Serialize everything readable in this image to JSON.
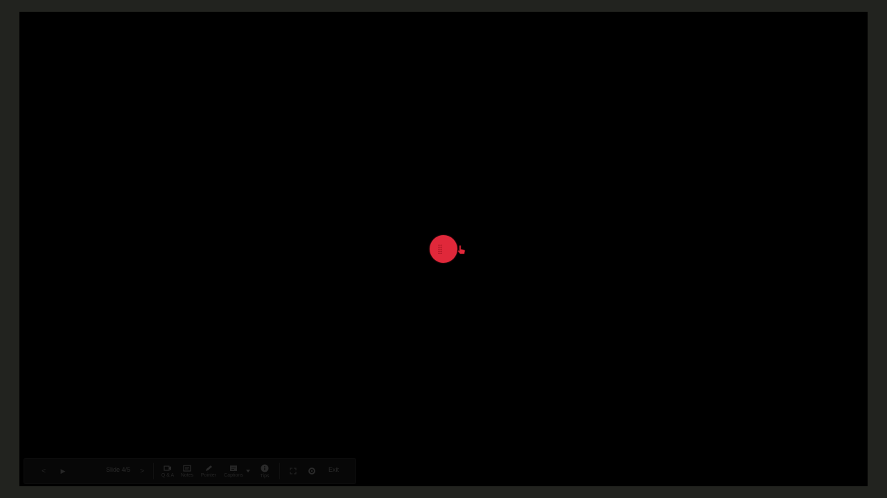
{
  "presenter": {
    "slide_counter": "Slide 4/5",
    "controls": {
      "prev_label": "<",
      "play_label": "▶",
      "next_label": ">",
      "exit_label": "Exit"
    },
    "tools": [
      {
        "icon": "camera-icon",
        "label": "Q & A"
      },
      {
        "icon": "notes-icon",
        "label": "Notes"
      },
      {
        "icon": "pen-icon",
        "label": "Pointer"
      },
      {
        "icon": "captions-icon",
        "label": "Captions"
      },
      {
        "icon": "info-icon",
        "label": "Tips"
      }
    ],
    "extra_icons": [
      "fullscreen-icon",
      "settings-icon"
    ]
  },
  "colors": {
    "frame": "#22231f",
    "stage": "#000000",
    "laser_pointer": "#e0283a"
  }
}
